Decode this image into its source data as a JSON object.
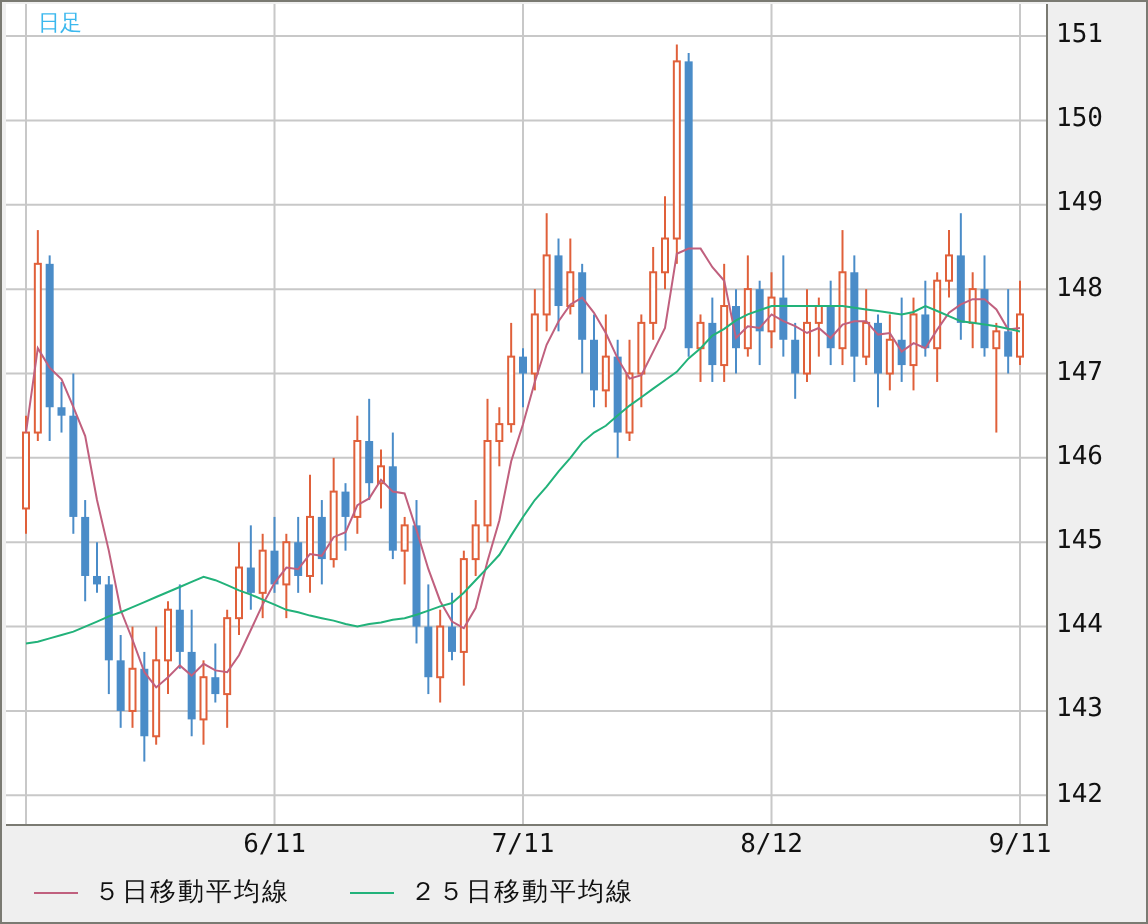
{
  "chart": {
    "period_label": "日足",
    "chart_data": {
      "type": "candlestick",
      "categories": [
        null,
        null,
        null,
        null,
        null,
        null,
        null,
        null,
        null,
        null,
        null,
        null,
        null,
        null,
        null,
        null,
        null,
        null,
        null,
        null,
        null,
        "6/11",
        null,
        null,
        null,
        null,
        null,
        null,
        null,
        null,
        null,
        null,
        null,
        null,
        null,
        null,
        null,
        null,
        null,
        null,
        null,
        null,
        "7/11",
        null,
        null,
        null,
        null,
        null,
        null,
        null,
        null,
        null,
        null,
        null,
        null,
        null,
        null,
        null,
        null,
        null,
        null,
        null,
        null,
        "8/12",
        null,
        null,
        null,
        null,
        null,
        null,
        null,
        null,
        null,
        null,
        null,
        null,
        null,
        null,
        null,
        null,
        null,
        null,
        null,
        null,
        "9/11"
      ],
      "ohlc": [
        [
          145.4,
          146.5,
          145.1,
          146.3
        ],
        [
          146.3,
          148.7,
          146.2,
          148.3
        ],
        [
          148.3,
          148.4,
          146.2,
          146.6
        ],
        [
          146.6,
          146.9,
          146.3,
          146.5
        ],
        [
          146.5,
          147.0,
          145.1,
          145.3
        ],
        [
          145.3,
          145.5,
          144.3,
          144.6
        ],
        [
          144.6,
          145.0,
          144.4,
          144.5
        ],
        [
          144.5,
          144.6,
          143.2,
          143.6
        ],
        [
          143.6,
          143.9,
          142.8,
          143.0
        ],
        [
          143.0,
          144.0,
          142.8,
          143.5
        ],
        [
          143.5,
          143.7,
          142.4,
          142.7
        ],
        [
          142.7,
          144.0,
          142.6,
          143.6
        ],
        [
          143.6,
          144.3,
          143.2,
          144.2
        ],
        [
          144.2,
          144.5,
          143.5,
          143.7
        ],
        [
          143.7,
          144.2,
          142.7,
          142.9
        ],
        [
          142.9,
          143.6,
          142.6,
          143.4
        ],
        [
          143.4,
          143.8,
          143.1,
          143.2
        ],
        [
          143.2,
          144.2,
          142.8,
          144.1
        ],
        [
          144.1,
          145.0,
          143.9,
          144.7
        ],
        [
          144.7,
          145.2,
          144.2,
          144.4
        ],
        [
          144.4,
          145.1,
          144.1,
          144.9
        ],
        [
          144.9,
          145.3,
          144.4,
          144.5
        ],
        [
          144.5,
          145.1,
          144.1,
          145.0
        ],
        [
          145.0,
          145.3,
          144.4,
          144.6
        ],
        [
          144.6,
          145.8,
          144.4,
          145.3
        ],
        [
          145.3,
          145.5,
          144.5,
          144.8
        ],
        [
          144.8,
          146.0,
          144.7,
          145.6
        ],
        [
          145.6,
          145.7,
          144.9,
          145.3
        ],
        [
          145.3,
          146.5,
          145.1,
          146.2
        ],
        [
          146.2,
          146.7,
          145.5,
          145.7
        ],
        [
          145.7,
          146.1,
          145.4,
          145.9
        ],
        [
          145.9,
          146.3,
          144.8,
          144.9
        ],
        [
          144.9,
          145.3,
          144.5,
          145.2
        ],
        [
          145.2,
          145.5,
          143.8,
          144.0
        ],
        [
          144.0,
          144.5,
          143.2,
          143.4
        ],
        [
          143.4,
          144.2,
          143.1,
          144.0
        ],
        [
          144.0,
          144.4,
          143.6,
          143.7
        ],
        [
          143.7,
          144.9,
          143.3,
          144.8
        ],
        [
          144.8,
          145.5,
          144.6,
          145.2
        ],
        [
          145.2,
          146.7,
          145.0,
          146.2
        ],
        [
          146.2,
          146.6,
          145.9,
          146.4
        ],
        [
          146.4,
          147.6,
          146.3,
          147.2
        ],
        [
          147.2,
          147.3,
          146.6,
          147.0
        ],
        [
          147.0,
          148.0,
          146.8,
          147.7
        ],
        [
          147.7,
          148.9,
          147.5,
          148.4
        ],
        [
          148.4,
          148.6,
          147.5,
          147.8
        ],
        [
          147.8,
          148.6,
          147.7,
          148.2
        ],
        [
          148.2,
          148.3,
          147.0,
          147.4
        ],
        [
          147.4,
          147.7,
          146.6,
          146.8
        ],
        [
          146.8,
          147.7,
          146.6,
          147.2
        ],
        [
          147.2,
          147.4,
          146.0,
          146.3
        ],
        [
          146.3,
          147.4,
          146.2,
          147.0
        ],
        [
          147.0,
          147.7,
          146.6,
          147.6
        ],
        [
          147.6,
          148.5,
          147.4,
          148.2
        ],
        [
          148.2,
          149.1,
          148.0,
          148.6
        ],
        [
          148.6,
          150.9,
          148.3,
          150.7
        ],
        [
          150.7,
          150.8,
          147.2,
          147.3
        ],
        [
          147.3,
          147.7,
          146.9,
          147.6
        ],
        [
          147.6,
          147.9,
          146.9,
          147.1
        ],
        [
          147.1,
          148.3,
          146.9,
          147.8
        ],
        [
          147.8,
          148.0,
          147.0,
          147.3
        ],
        [
          147.3,
          148.4,
          147.2,
          148.0
        ],
        [
          148.0,
          148.1,
          147.1,
          147.5
        ],
        [
          147.5,
          148.2,
          147.3,
          147.9
        ],
        [
          147.9,
          148.4,
          147.2,
          147.4
        ],
        [
          147.4,
          147.6,
          146.7,
          147.0
        ],
        [
          147.0,
          148.0,
          146.9,
          147.6
        ],
        [
          147.6,
          147.9,
          147.2,
          147.8
        ],
        [
          147.8,
          148.1,
          147.1,
          147.3
        ],
        [
          147.3,
          148.7,
          147.1,
          148.2
        ],
        [
          148.2,
          148.4,
          146.9,
          147.2
        ],
        [
          147.2,
          148.0,
          147.1,
          147.6
        ],
        [
          147.6,
          147.7,
          146.6,
          147.0
        ],
        [
          147.0,
          147.7,
          146.8,
          147.4
        ],
        [
          147.4,
          147.9,
          146.9,
          147.1
        ],
        [
          147.1,
          147.9,
          146.8,
          147.7
        ],
        [
          147.7,
          148.1,
          147.2,
          147.3
        ],
        [
          147.3,
          148.2,
          146.9,
          148.1
        ],
        [
          148.1,
          148.7,
          147.9,
          148.4
        ],
        [
          148.4,
          148.9,
          147.4,
          147.6
        ],
        [
          147.6,
          148.2,
          147.3,
          148.0
        ],
        [
          148.0,
          148.4,
          147.2,
          147.3
        ],
        [
          147.3,
          147.6,
          146.3,
          147.5
        ],
        [
          147.5,
          148.0,
          147.0,
          147.2
        ],
        [
          147.2,
          148.1,
          147.1,
          147.7
        ]
      ],
      "series": [
        {
          "name": "５日移動平均線",
          "type": "line",
          "color": "#c0607e",
          "values": [
            146.3,
            147.3,
            147.07,
            146.93,
            146.6,
            146.26,
            145.5,
            144.9,
            144.2,
            143.84,
            143.46,
            143.28,
            143.4,
            143.54,
            143.42,
            143.56,
            143.48,
            143.46,
            143.66,
            143.96,
            144.26,
            144.52,
            144.7,
            144.68,
            144.86,
            144.84,
            145.06,
            145.12,
            145.44,
            145.52,
            145.74,
            145.6,
            145.58,
            145.14,
            144.68,
            144.3,
            144.06,
            143.98,
            144.22,
            144.78,
            145.26,
            145.96,
            146.4,
            146.9,
            147.34,
            147.62,
            147.82,
            147.9,
            147.72,
            147.48,
            147.18,
            146.94,
            146.98,
            147.26,
            147.54,
            148.42,
            148.48,
            148.48,
            148.26,
            148.1,
            147.42,
            147.56,
            147.54,
            147.7,
            147.62,
            147.56,
            147.48,
            147.54,
            147.42,
            147.58,
            147.62,
            147.62,
            147.46,
            147.48,
            147.26,
            147.36,
            147.3,
            147.52,
            147.72,
            147.82,
            147.88,
            147.88,
            147.76,
            147.52,
            147.54
          ]
        },
        {
          "name": "２５日移動平均線",
          "type": "line",
          "color": "#22b27a",
          "values": [
            143.8,
            143.82,
            143.86,
            143.9,
            143.94,
            144.0,
            144.06,
            144.12,
            144.17,
            144.23,
            144.29,
            144.35,
            144.41,
            144.47,
            144.53,
            144.59,
            144.55,
            144.49,
            144.43,
            144.38,
            144.32,
            144.26,
            144.2,
            144.17,
            144.13,
            144.1,
            144.07,
            144.03,
            144.0,
            144.03,
            144.05,
            144.08,
            144.1,
            144.14,
            144.19,
            144.24,
            144.28,
            144.4,
            144.55,
            144.7,
            144.85,
            145.08,
            145.3,
            145.5,
            145.66,
            145.84,
            146.0,
            146.18,
            146.3,
            146.38,
            146.5,
            146.62,
            146.72,
            146.82,
            146.92,
            147.02,
            147.18,
            147.3,
            147.45,
            147.53,
            147.63,
            147.7,
            147.75,
            147.8,
            147.8,
            147.8,
            147.8,
            147.8,
            147.8,
            147.8,
            147.78,
            147.76,
            147.74,
            147.72,
            147.7,
            147.73,
            147.8,
            147.74,
            147.68,
            147.62,
            147.6,
            147.58,
            147.56,
            147.53,
            147.5
          ]
        }
      ],
      "ylim": [
        141.66,
        151.38
      ],
      "yticks": [
        151,
        150,
        149,
        148,
        147,
        146,
        145,
        144,
        143,
        142
      ],
      "grid": true,
      "legend": "bottom"
    }
  }
}
